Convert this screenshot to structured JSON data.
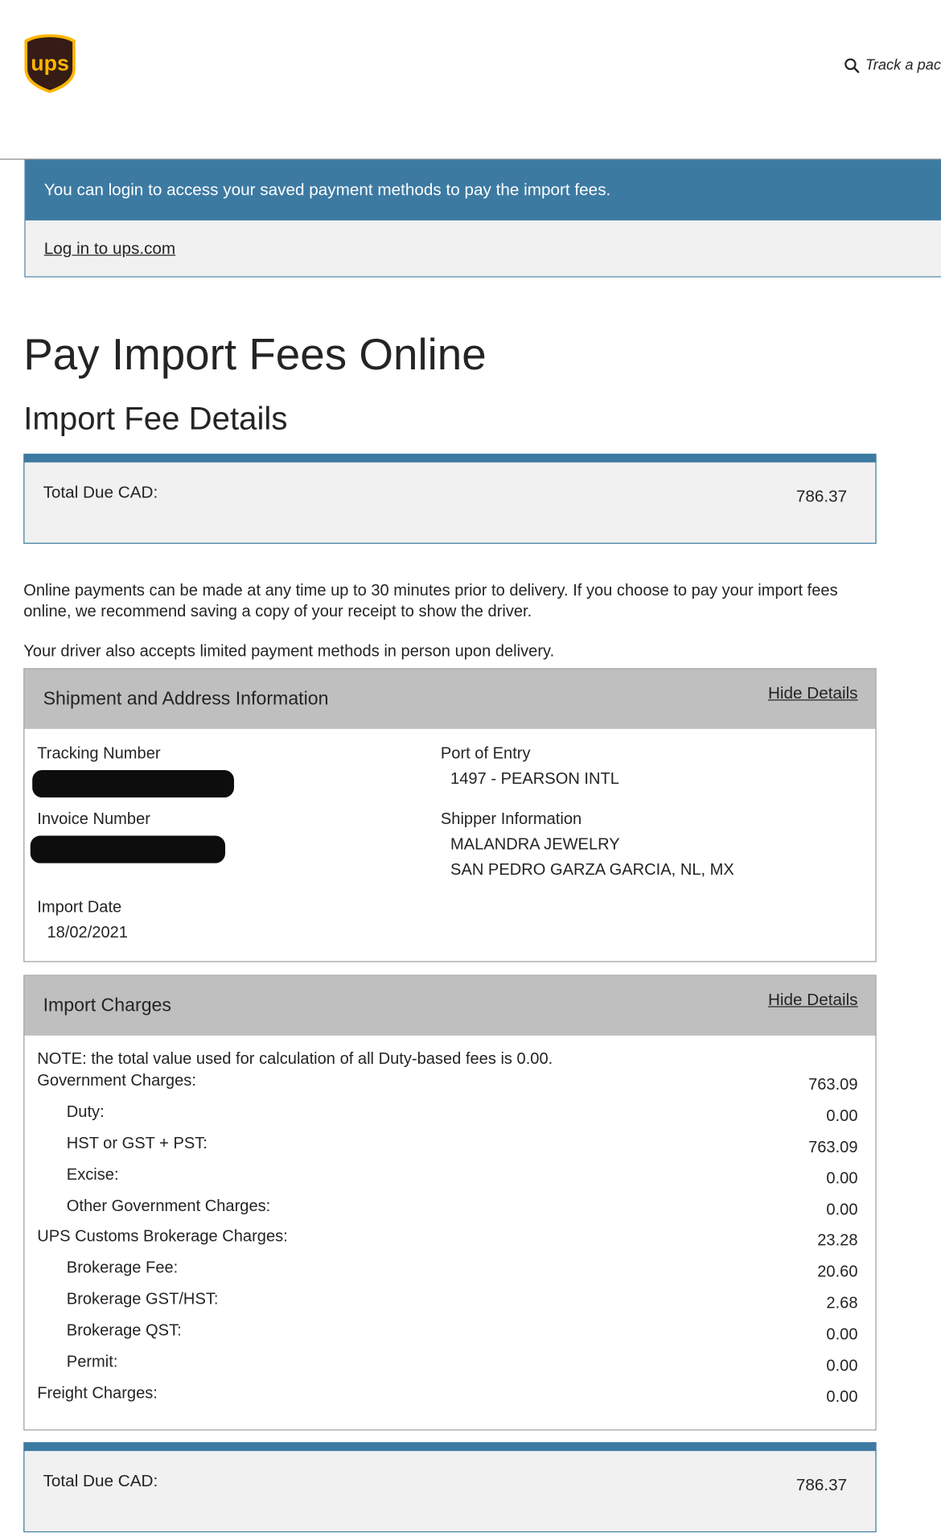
{
  "header": {
    "logo_text": "ups",
    "track_link": "Track a pac"
  },
  "login_banner": {
    "message": "You can login to access your saved payment methods to pay the import fees.",
    "link": "Log in to ups.com"
  },
  "page_title": "Pay Import Fees Online",
  "section_title": "Import Fee Details",
  "total_top": {
    "label": "Total Due CAD:",
    "value": "786.37"
  },
  "info": {
    "paragraph1": "Online payments can be made at any time up to 30 minutes prior to delivery. If you choose to pay your import fees online, we recommend saving a copy of your receipt to show the driver.",
    "paragraph2": "Your driver also accepts limited payment methods in person upon delivery."
  },
  "shipment": {
    "title": "Shipment and Address Information",
    "hide_label": "Hide Details",
    "tracking_label": "Tracking Number",
    "invoice_label": "Invoice Number",
    "import_date_label": "Import Date",
    "import_date": "18/02/2021",
    "port_label": "Port of Entry",
    "port_value": "1497 - PEARSON INTL",
    "shipper_label": "Shipper Information",
    "shipper_name": "MALANDRA JEWELRY",
    "shipper_location": "SAN PEDRO GARZA GARCIA,  NL,  MX"
  },
  "charges": {
    "title": "Import Charges",
    "hide_label": "Hide Details",
    "note": "NOTE: the total value used for calculation of all Duty-based fees is 0.00.",
    "rows": [
      {
        "label": "Government Charges:",
        "value": "763.09"
      },
      {
        "label": "Duty:",
        "value": "0.00"
      },
      {
        "label": "HST or GST + PST:",
        "value": "763.09"
      },
      {
        "label": "Excise:",
        "value": "0.00"
      },
      {
        "label": "Other Government Charges:",
        "value": "0.00"
      },
      {
        "label": "UPS Customs Brokerage Charges:",
        "value": "23.28"
      },
      {
        "label": "Brokerage Fee:",
        "value": "20.60"
      },
      {
        "label": "Brokerage GST/HST:",
        "value": "2.68"
      },
      {
        "label": "Brokerage QST:",
        "value": "0.00"
      },
      {
        "label": "Permit:",
        "value": "0.00"
      },
      {
        "label": "Freight Charges:",
        "value": "0.00"
      }
    ]
  },
  "total_bottom": {
    "label": "Total Due CAD:",
    "value": "786.37"
  },
  "colors": {
    "brand_brown": "#351c15",
    "brand_gold": "#ffb500",
    "banner_blue": "#3c7aa2",
    "panel_header_gray": "#bfbfbf",
    "box_background": "#f1f1f1"
  }
}
